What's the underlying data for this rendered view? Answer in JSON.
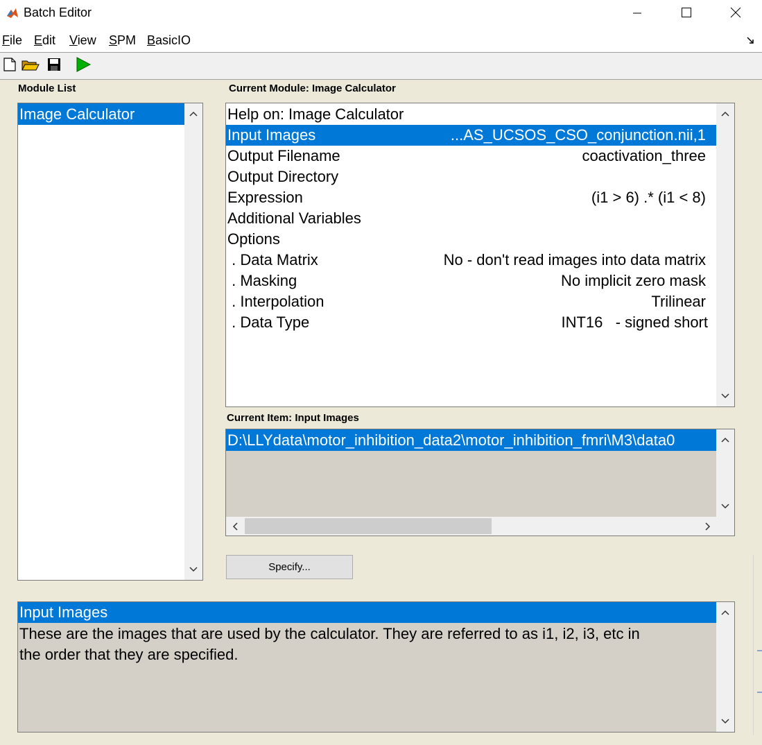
{
  "window": {
    "title": "Batch Editor",
    "controls": {
      "minimize": "minimize-icon",
      "maximize": "maximize-icon",
      "close": "close-icon"
    }
  },
  "menu": {
    "file": {
      "mnemonic": "F",
      "rest": "ile"
    },
    "edit": {
      "mnemonic": "E",
      "rest": "dit"
    },
    "view": {
      "mnemonic": "V",
      "rest": "iew"
    },
    "spm": {
      "mnemonic": "S",
      "rest": "PM"
    },
    "basicio": {
      "mnemonic": "B",
      "rest": "asicIO"
    }
  },
  "toolbar": {
    "icons": [
      "new-file-icon",
      "open-folder-icon",
      "save-icon",
      "run-icon"
    ],
    "colors": {
      "run": "#00b000",
      "folder": "#e8b400"
    }
  },
  "module_list": {
    "label": "Module List",
    "items": [
      "Image Calculator"
    ]
  },
  "current_module": {
    "label": "Current Module: Image Calculator",
    "rows": [
      {
        "key": "Help on: Image Calculator",
        "value": ""
      },
      {
        "key": "Input Images",
        "value": "...AS_UCSOS_CSO_conjunction.nii,1",
        "selected": true
      },
      {
        "key": "Output Filename",
        "value": "coactivation_three"
      },
      {
        "key": "Output Directory",
        "value": ""
      },
      {
        "key": "Expression",
        "value": "(i1 > 6) .* (i1 < 8)"
      },
      {
        "key": "Additional Variables",
        "value": ""
      },
      {
        "key": "Options",
        "value": ""
      },
      {
        "key": " . Data Matrix",
        "value": "No - don't read images into data matrix"
      },
      {
        "key": " . Masking",
        "value": "No implicit zero mask"
      },
      {
        "key": " . Interpolation",
        "value": "Trilinear"
      },
      {
        "key": " . Data Type",
        "value": "INT16   - signed short"
      }
    ]
  },
  "current_item": {
    "label": "Current Item: Input Images",
    "value": "D:\\LLYdata\\motor_inhibition_data2\\motor_inhibition_fmri\\M3\\data0"
  },
  "specify_button": "Specify...",
  "help": {
    "title": "Input Images",
    "line1": "These are the images that are used by the calculator.  They are referred to as i1, i2, i3, etc in",
    "line2": "the order that they are specified."
  },
  "colors": {
    "selection": "#0078d7",
    "background": "#ece9d8",
    "panel_gray": "#d4d0c8"
  }
}
